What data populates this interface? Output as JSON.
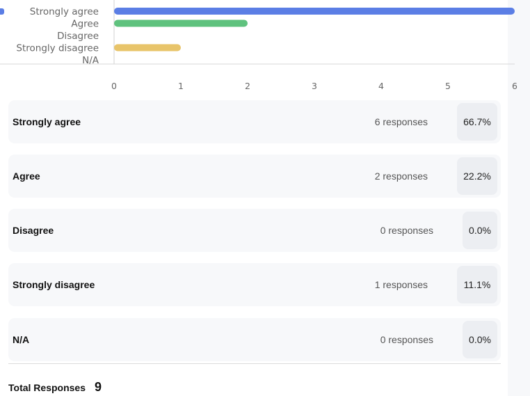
{
  "chart_data": {
    "type": "bar",
    "orientation": "horizontal",
    "categories": [
      "Strongly agree",
      "Agree",
      "Disagree",
      "Strongly disagree",
      "N/A"
    ],
    "values": [
      6,
      2,
      0,
      1,
      0
    ],
    "xticks": [
      "0",
      "1",
      "2",
      "3",
      "4",
      "5",
      "6"
    ],
    "xlim": [
      0,
      6
    ],
    "colors": [
      "#5b7ee5",
      "#5fc27e",
      "#5fc27e",
      "#e8c46a",
      "#e8c46a"
    ],
    "grid": false
  },
  "rows": [
    {
      "label": "Strongly agree",
      "responses": "6 responses",
      "percent": "66.7%"
    },
    {
      "label": "Agree",
      "responses": "2 responses",
      "percent": "22.2%"
    },
    {
      "label": "Disagree",
      "responses": "0 responses",
      "percent": "0.0%"
    },
    {
      "label": "Strongly disagree",
      "responses": "1 responses",
      "percent": "11.1%"
    },
    {
      "label": "N/A",
      "responses": "0 responses",
      "percent": "0.0%"
    }
  ],
  "total": {
    "label": "Total Responses",
    "value": "9"
  }
}
